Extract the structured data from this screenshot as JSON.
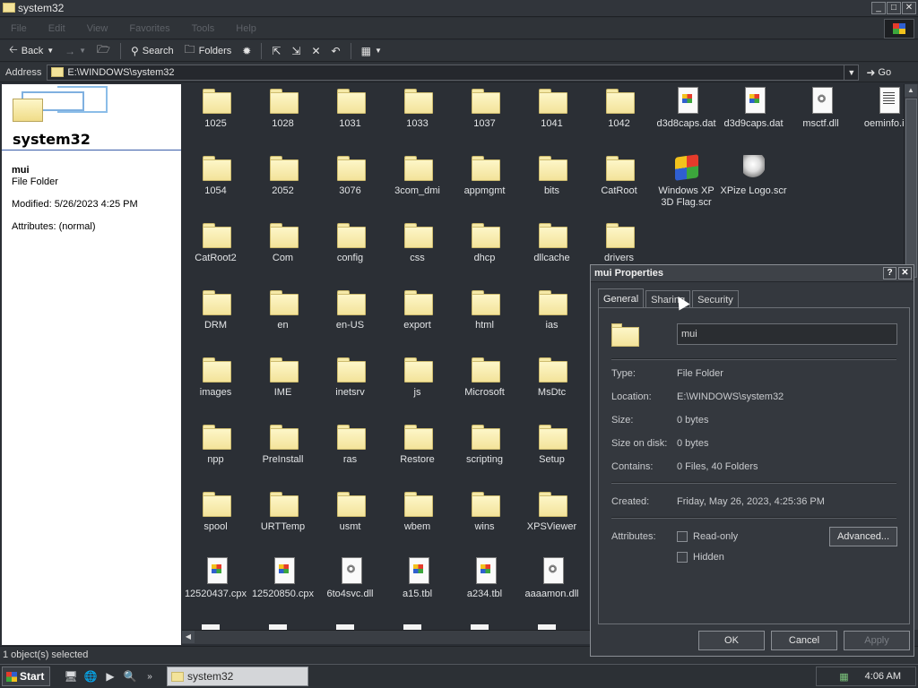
{
  "window": {
    "title": "system32"
  },
  "menu": [
    "File",
    "Edit",
    "View",
    "Favorites",
    "Tools",
    "Help"
  ],
  "toolbar": {
    "back": "Back",
    "search": "Search",
    "folders": "Folders"
  },
  "address": {
    "label": "Address",
    "path": "E:\\WINDOWS\\system32",
    "go": "Go"
  },
  "leftpane": {
    "title": "system32",
    "selected_name": "mui",
    "selected_type": "File Folder",
    "modified": "Modified: 5/26/2023 4:25 PM",
    "attributes": "Attributes: (normal)"
  },
  "items": [
    {
      "label": "1025",
      "kind": "folder"
    },
    {
      "label": "1028",
      "kind": "folder"
    },
    {
      "label": "1031",
      "kind": "folder"
    },
    {
      "label": "1033",
      "kind": "folder"
    },
    {
      "label": "1037",
      "kind": "folder"
    },
    {
      "label": "1041",
      "kind": "folder"
    },
    {
      "label": "1042",
      "kind": "folder"
    },
    {
      "label": "d3d8caps.dat",
      "kind": "file"
    },
    {
      "label": "d3d9caps.dat",
      "kind": "file"
    },
    {
      "label": "msctf.dll",
      "kind": "gear"
    },
    {
      "label": "oeminfo.ini",
      "kind": "txt"
    },
    {
      "label": "1054",
      "kind": "folder"
    },
    {
      "label": "2052",
      "kind": "folder"
    },
    {
      "label": "3076",
      "kind": "folder"
    },
    {
      "label": "3com_dmi",
      "kind": "folder"
    },
    {
      "label": "appmgmt",
      "kind": "folder"
    },
    {
      "label": "bits",
      "kind": "folder"
    },
    {
      "label": "CatRoot",
      "kind": "folder"
    },
    {
      "label": "Windows XP 3D Flag.scr",
      "kind": "flag"
    },
    {
      "label": "XPize Logo.scr",
      "kind": "pxlogo"
    },
    {
      "label": "CatRoot2",
      "kind": "folder"
    },
    {
      "label": "Com",
      "kind": "folder"
    },
    {
      "label": "config",
      "kind": "folder"
    },
    {
      "label": "css",
      "kind": "folder"
    },
    {
      "label": "dhcp",
      "kind": "folder"
    },
    {
      "label": "dllcache",
      "kind": "folder"
    },
    {
      "label": "drivers",
      "kind": "folder"
    },
    {
      "label": "DRM",
      "kind": "folder"
    },
    {
      "label": "en",
      "kind": "folder"
    },
    {
      "label": "en-US",
      "kind": "folder"
    },
    {
      "label": "export",
      "kind": "folder"
    },
    {
      "label": "html",
      "kind": "folder"
    },
    {
      "label": "ias",
      "kind": "folder"
    },
    {
      "label": "images",
      "kind": "folder"
    },
    {
      "label": "IME",
      "kind": "folder"
    },
    {
      "label": "inetsrv",
      "kind": "folder"
    },
    {
      "label": "js",
      "kind": "folder"
    },
    {
      "label": "Microsoft",
      "kind": "folder"
    },
    {
      "label": "MsDtc",
      "kind": "folder"
    },
    {
      "label": "npp",
      "kind": "folder"
    },
    {
      "label": "PreInstall",
      "kind": "folder"
    },
    {
      "label": "ras",
      "kind": "folder"
    },
    {
      "label": "Restore",
      "kind": "folder"
    },
    {
      "label": "scripting",
      "kind": "folder"
    },
    {
      "label": "Setup",
      "kind": "folder"
    },
    {
      "label": "spool",
      "kind": "folder"
    },
    {
      "label": "URTTemp",
      "kind": "folder"
    },
    {
      "label": "usmt",
      "kind": "folder"
    },
    {
      "label": "wbem",
      "kind": "folder"
    },
    {
      "label": "wins",
      "kind": "folder"
    },
    {
      "label": "XPSViewer",
      "kind": "folder"
    },
    {
      "label": "12520437.cpx",
      "kind": "file"
    },
    {
      "label": "12520850.cpx",
      "kind": "file"
    },
    {
      "label": "6to4svc.dll",
      "kind": "gear"
    },
    {
      "label": "a15.tbl",
      "kind": "file"
    },
    {
      "label": "a234.tbl",
      "kind": "file"
    },
    {
      "label": "aaaamon.dll",
      "kind": "gear"
    }
  ],
  "status": {
    "text": "1 object(s) selected"
  },
  "taskbar": {
    "start": "Start",
    "task": "system32",
    "clock": "4:06 AM"
  },
  "dialog": {
    "title": "mui Properties",
    "tabs": [
      "General",
      "Sharing",
      "Security"
    ],
    "name": "mui",
    "type_label": "Type:",
    "type_value": "File Folder",
    "location_label": "Location:",
    "location_value": "E:\\WINDOWS\\system32",
    "size_label": "Size:",
    "size_value": "0 bytes",
    "sizeondisk_label": "Size on disk:",
    "sizeondisk_value": "0 bytes",
    "contains_label": "Contains:",
    "contains_value": "0 Files, 40 Folders",
    "created_label": "Created:",
    "created_value": "Friday, May 26, 2023, 4:25:36 PM",
    "attributes_label": "Attributes:",
    "readonly": "Read-only",
    "hidden": "Hidden",
    "advanced": "Advanced...",
    "ok": "OK",
    "cancel": "Cancel",
    "apply": "Apply"
  }
}
